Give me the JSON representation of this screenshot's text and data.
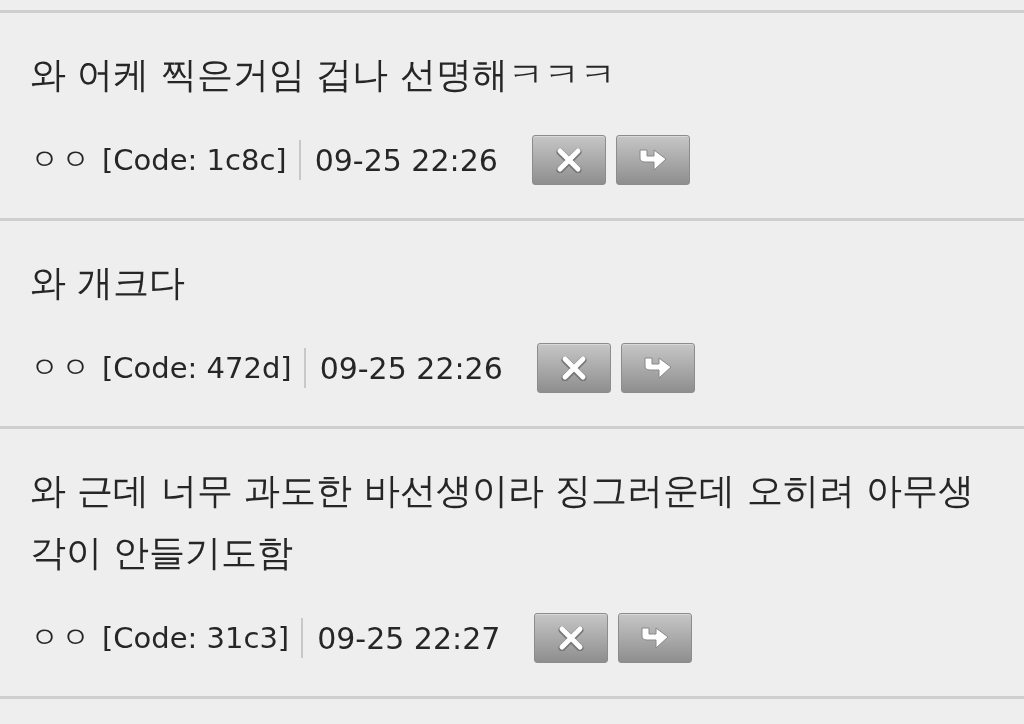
{
  "comments": [
    {
      "text": "와 어케 찍은거임 겁나 선명해ㅋㅋㅋ",
      "author": "ㅇㅇ",
      "code": "[Code: 1c8c]",
      "time": "09-25 22:26"
    },
    {
      "text": "와 개크다",
      "author": "ㅇㅇ",
      "code": "[Code: 472d]",
      "time": "09-25 22:26"
    },
    {
      "text": "와 근데 너무 과도한 바선생이라 징그러운데 오히려 아무생각이 안들기도함",
      "author": "ㅇㅇ",
      "code": "[Code: 31c3]",
      "time": "09-25 22:27"
    }
  ]
}
